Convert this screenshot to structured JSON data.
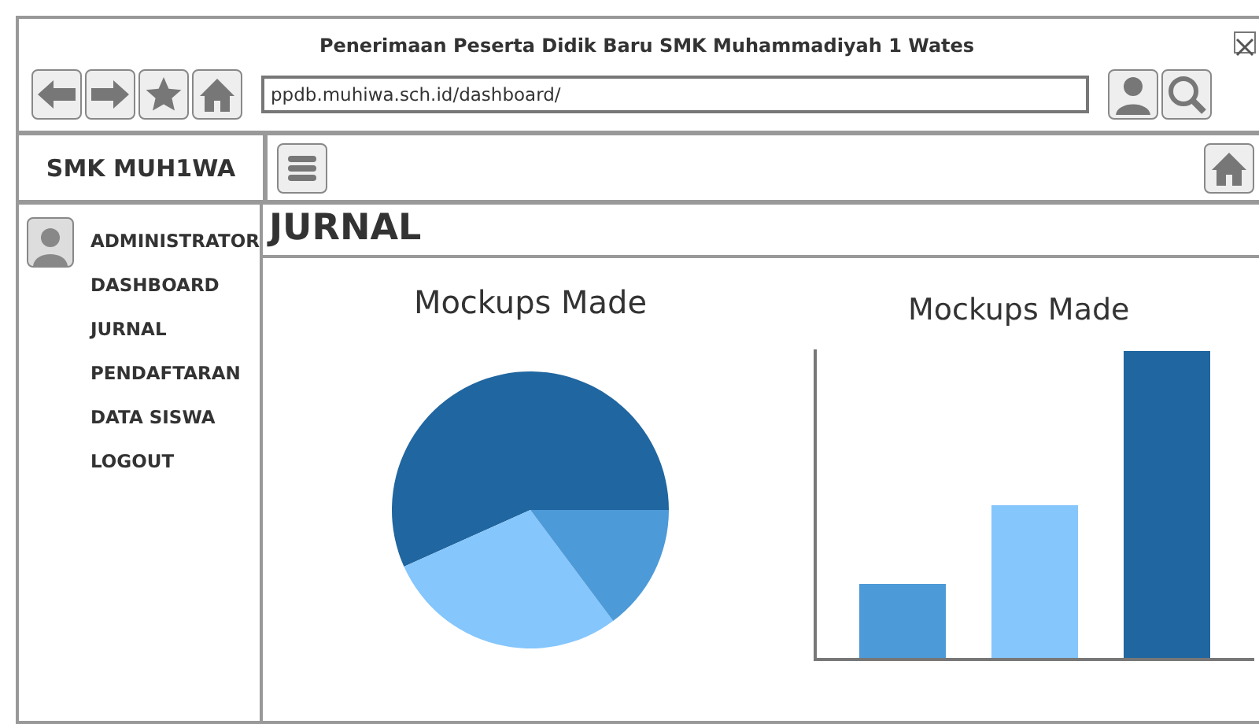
{
  "browser": {
    "title": "Penerimaan Peserta Didik Baru SMK Muhammadiyah 1 Wates",
    "url": "ppdb.muhiwa.sch.id/dashboard/"
  },
  "header": {
    "brand": "SMK MUH1WA"
  },
  "sidebar": {
    "user": "ADMINISTRATOR",
    "items": [
      {
        "label": "DASHBOARD"
      },
      {
        "label": "JURNAL"
      },
      {
        "label": "PENDAFTARAN"
      },
      {
        "label": "DATA SISWA"
      },
      {
        "label": "LOGOUT"
      }
    ]
  },
  "main": {
    "heading": "JURNAL",
    "pie": {
      "title": "Mockups Made"
    },
    "bar": {
      "title": "Mockups Made"
    }
  }
}
